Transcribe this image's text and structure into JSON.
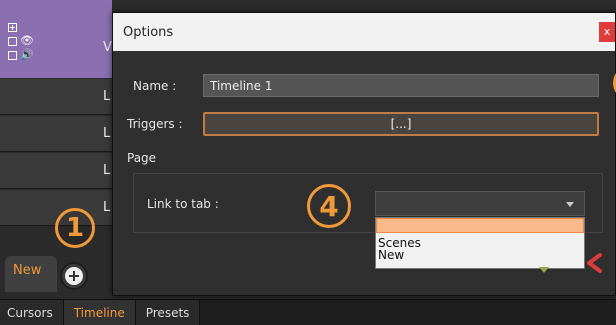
{
  "dialog": {
    "title": "Options",
    "close_label": "x",
    "name_label": "Name :",
    "name_value": "Timeline 1",
    "triggers_label": "Triggers :",
    "triggers_button": "[...]",
    "page_section": "Page",
    "link_to_tab_label": "Link to tab :",
    "link_to_tab_value": "",
    "link_to_tab_options": [
      "",
      "Scenes",
      "New"
    ]
  },
  "sidebar": {
    "track_letter": "V",
    "layer_letters": [
      "L",
      "L",
      "L",
      "L"
    ]
  },
  "tabs": {
    "new_tab": "New"
  },
  "bottom_tabs": [
    "Cursors",
    "Timeline",
    "Presets"
  ],
  "annotations": {
    "one": "1",
    "four": "4"
  },
  "colors": {
    "accent": "#f29a3a",
    "track": "#8b6fb0",
    "close": "#e03b3b"
  }
}
